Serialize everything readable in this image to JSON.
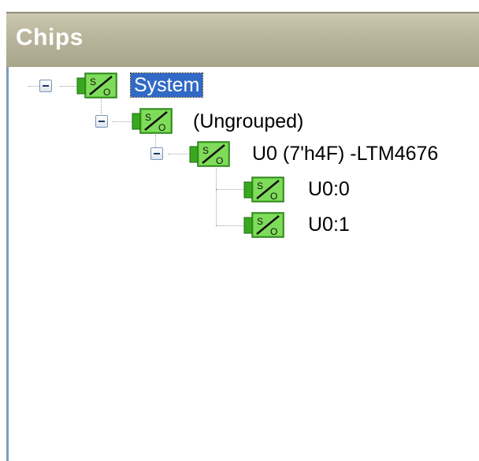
{
  "panel": {
    "title": "Chips"
  },
  "tree": {
    "root": {
      "label": "System",
      "selected": true
    },
    "group": {
      "label": "(Ungrouped)"
    },
    "device": {
      "label": "U0 (7'h4F) -LTM4676"
    },
    "channels": [
      {
        "label": "U0:0"
      },
      {
        "label": "U0:1"
      }
    ]
  },
  "icons": {
    "node": "power-module-so-icon",
    "expand": "collapse-minus-icon"
  },
  "colors": {
    "selection": "#3169c6",
    "icon_green": "#5cc83a",
    "title_bar": "#b8b59c"
  }
}
